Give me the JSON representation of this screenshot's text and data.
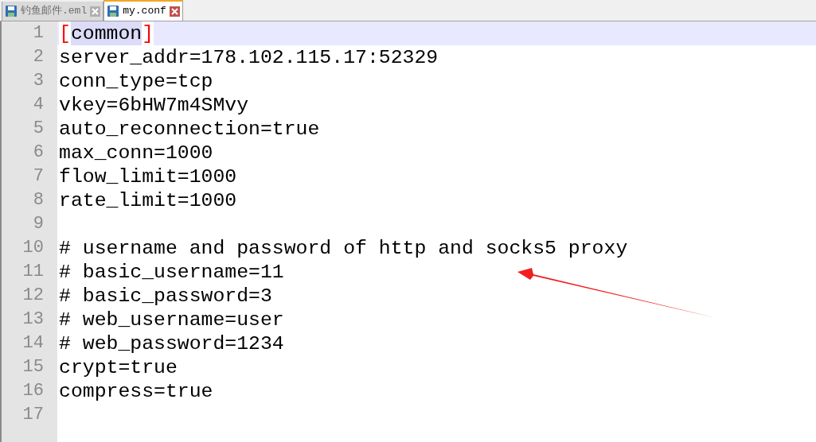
{
  "tabs": [
    {
      "label": "钓鱼邮件.eml",
      "selected": false
    },
    {
      "label": "my.conf",
      "selected": true
    }
  ],
  "lines": [
    {
      "number": "1",
      "current": true,
      "parts": [
        {
          "kind": "brace",
          "text": "["
        },
        {
          "kind": "word",
          "text": "common"
        },
        {
          "kind": "brace",
          "text": "]"
        }
      ]
    },
    {
      "number": "2",
      "current": false,
      "text": "server_addr=178.102.115.17:52329"
    },
    {
      "number": "3",
      "current": false,
      "text": "conn_type=tcp"
    },
    {
      "number": "4",
      "current": false,
      "text": "vkey=6bHW7m4SMvy"
    },
    {
      "number": "5",
      "current": false,
      "text": "auto_reconnection=true"
    },
    {
      "number": "6",
      "current": false,
      "text": "max_conn=1000"
    },
    {
      "number": "7",
      "current": false,
      "text": "flow_limit=1000"
    },
    {
      "number": "8",
      "current": false,
      "text": "rate_limit=1000"
    },
    {
      "number": "9",
      "current": false
    },
    {
      "number": "10",
      "current": false,
      "text": "# username and password of http and socks5 proxy"
    },
    {
      "number": "11",
      "current": false,
      "text": "# basic_username=11"
    },
    {
      "number": "12",
      "current": false,
      "text": "# basic_password=3"
    },
    {
      "number": "13",
      "current": false,
      "text": "# web_username=user"
    },
    {
      "number": "14",
      "current": false,
      "text": "# web_password=1234"
    },
    {
      "number": "15",
      "current": false,
      "text": "crypt=true"
    },
    {
      "number": "16",
      "current": false,
      "text": "compress=true"
    },
    {
      "number": "17",
      "current": false
    }
  ]
}
